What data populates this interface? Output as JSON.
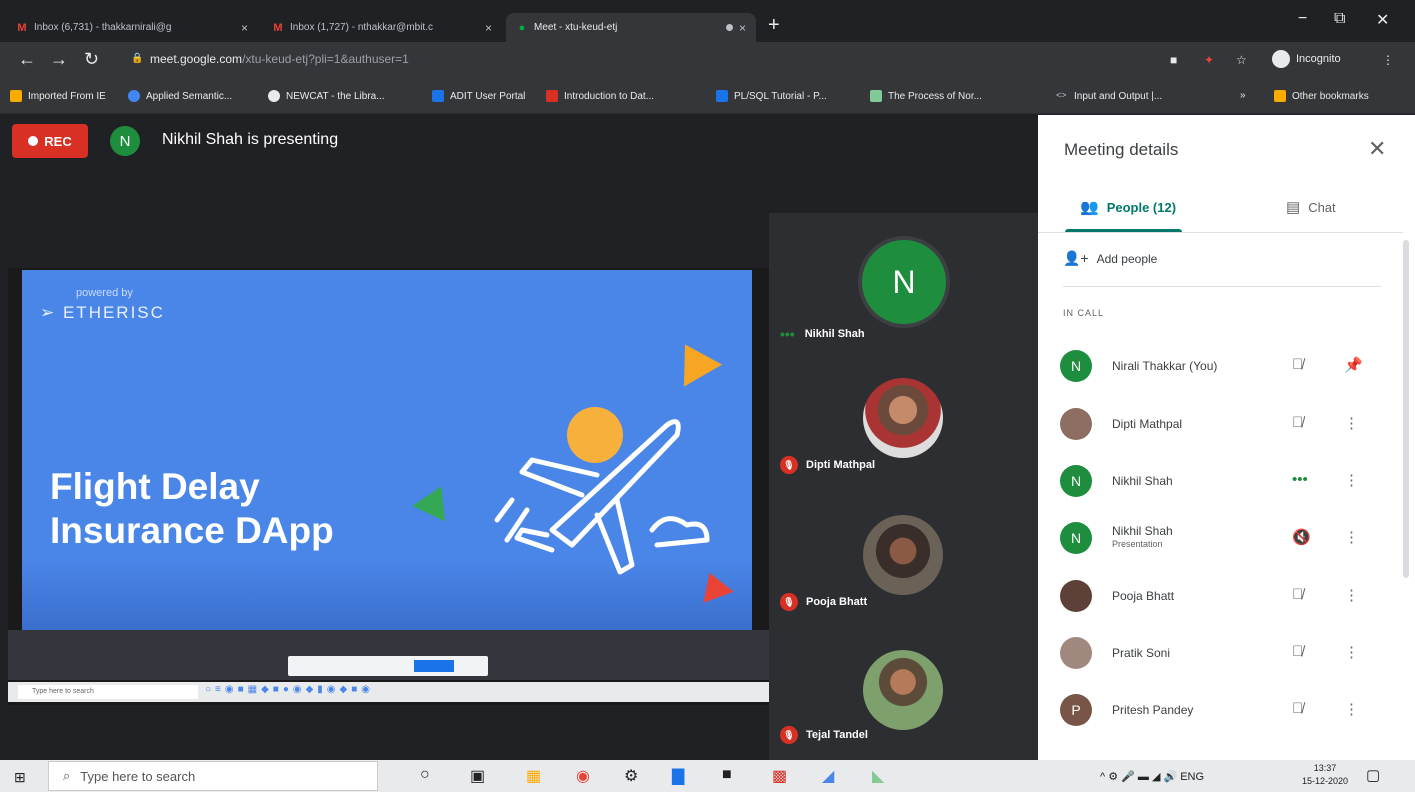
{
  "browser": {
    "tabs": [
      {
        "title": "Inbox (6,731) - thakkarnirali@g",
        "close": "×"
      },
      {
        "title": "Inbox (1,727) - nthakkar@mbit.c",
        "close": "×"
      },
      {
        "title": "Meet - xtu-keud-etj",
        "close": "×"
      }
    ],
    "new_tab": "+",
    "window_min": "−",
    "window_max": "⧉",
    "window_close": "✕",
    "url_host": "meet.google.com",
    "url_path": "/xtu-keud-etj?pli=1&authuser=1",
    "incognito_label": "Incognito",
    "bookmarks": [
      "Imported From IE",
      "Applied Semantic...",
      "NEWCAT - the Libra...",
      "ADIT User Portal",
      "Introduction to Dat...",
      "PL/SQL Tutorial - P...",
      "The Process of Nor...",
      "Input and Output |...",
      "»",
      "Other bookmarks"
    ]
  },
  "meeting": {
    "rec_label": "REC",
    "presenter_initial": "N",
    "presenter_text": "Nikhil Shah is presenting",
    "slide": {
      "powered_by": "powered by",
      "logo": "ETHERISC",
      "title_line1": "Flight Delay",
      "title_line2": "Insurance DApp"
    },
    "mini_search": "Type here to search",
    "filmstrip": [
      {
        "name": "Nikhil Shah",
        "initial": "N"
      },
      {
        "name": "Dipti Mathpal"
      },
      {
        "name": "Pooja Bhatt"
      },
      {
        "name": "Tejal Tandel"
      }
    ]
  },
  "panel": {
    "title": "Meeting details",
    "close": "✕",
    "tab_people": "People (12)",
    "tab_chat": "Chat",
    "add_people": "Add people",
    "in_call": "IN CALL",
    "participants": [
      {
        "name": "Nirali Thakkar (You)",
        "initial": "N",
        "color": "#1e8e3e",
        "sub": ""
      },
      {
        "name": "Dipti Mathpal",
        "initial": "",
        "color": "#8d6e63",
        "sub": ""
      },
      {
        "name": "Nikhil Shah",
        "initial": "N",
        "color": "#1e8e3e",
        "sub": ""
      },
      {
        "name": "Nikhil Shah",
        "initial": "N",
        "color": "#1e8e3e",
        "sub": "Presentation"
      },
      {
        "name": "Pooja Bhatt",
        "initial": "",
        "color": "#5d4037",
        "sub": ""
      },
      {
        "name": "Pratik Soni",
        "initial": "",
        "color": "#a1887f",
        "sub": ""
      },
      {
        "name": "Pritesh Pandey",
        "initial": "P",
        "color": "#795548",
        "sub": ""
      }
    ]
  },
  "taskbar": {
    "search_placeholder": "Type here to search",
    "lang": "ENG",
    "time": "13:37",
    "date": "15-12-2020"
  }
}
